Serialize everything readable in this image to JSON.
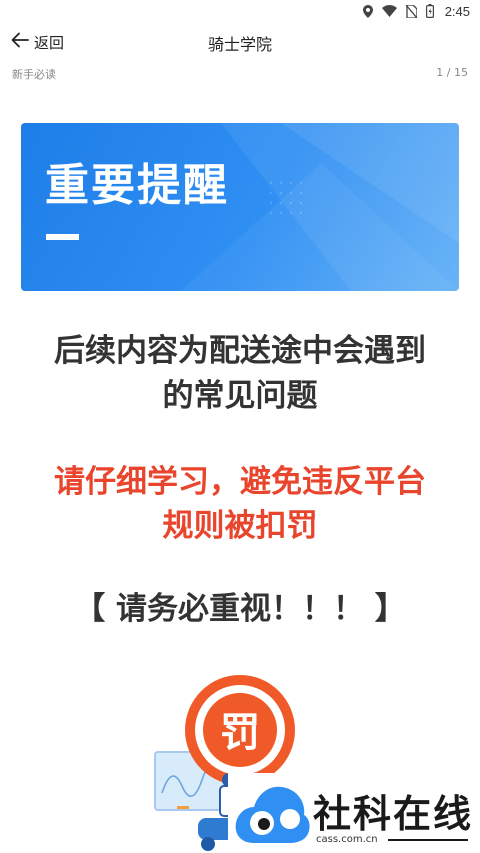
{
  "status_bar": {
    "time": "2:45",
    "icons": [
      "location-icon",
      "wifi-icon",
      "no-sim-icon",
      "battery-icon"
    ]
  },
  "header": {
    "back_label": "返回",
    "title": "骑士学院"
  },
  "sub_header": {
    "section": "新手必读",
    "page_counter": "1 / 15"
  },
  "banner": {
    "title": "重要提醒",
    "colors": {
      "start": "#1e7ee8",
      "end": "#5eaef7"
    }
  },
  "content": {
    "line1": "后续内容为配送途中会遇到",
    "line2": "的常见问题",
    "line3": "请仔细学习，避免违反平台",
    "line4": "规则被扣罚",
    "line5": "【 请务必重视！！！ 】"
  },
  "illustration": {
    "badge_text": "罚",
    "accent": "#f05a28"
  },
  "watermark": {
    "text": "社科在线",
    "url": "cass.com.cn"
  }
}
